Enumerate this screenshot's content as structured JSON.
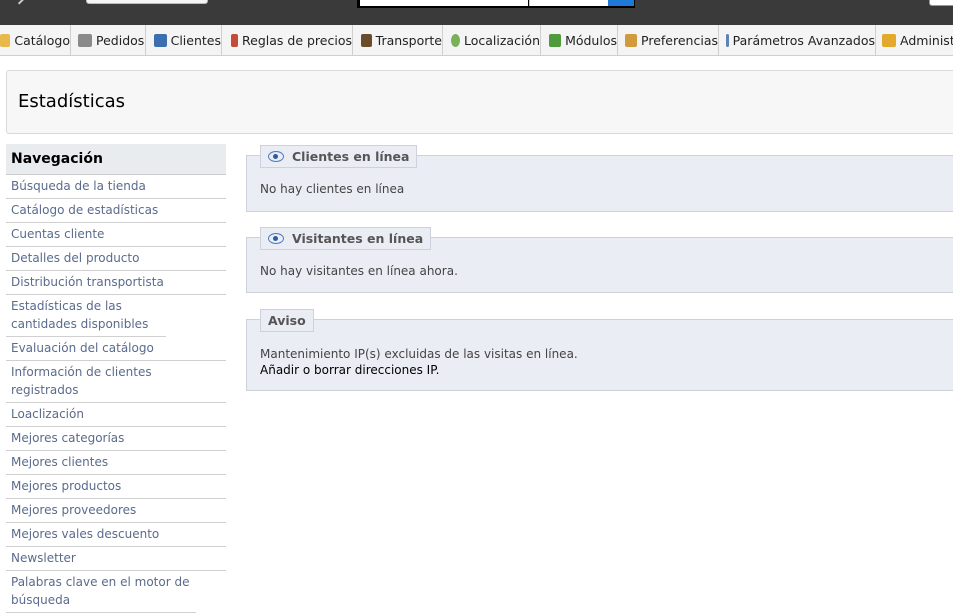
{
  "header": {
    "search": {
      "placeholder": ""
    }
  },
  "menu": [
    {
      "label": "Catálogo",
      "color": "#e8b94a"
    },
    {
      "label": "Pedidos",
      "color": "#8a8a8a"
    },
    {
      "label": "Clientes",
      "color": "#3c6fb0"
    },
    {
      "label": "Reglas de precios",
      "color": "#c64a3a"
    },
    {
      "label": "Transporte",
      "color": "#6a4b2c"
    },
    {
      "label": "Localización",
      "color": "#7ab05a"
    },
    {
      "label": "Módulos",
      "color": "#4f9a3a"
    },
    {
      "label": "Preferencias",
      "color": "#d19a3a"
    },
    {
      "label": "Parámetros Avanzados",
      "color": "#5b84b1"
    },
    {
      "label": "Administr",
      "color": "#e2a92c"
    }
  ],
  "page": {
    "title": "Estadísticas"
  },
  "sidebar": {
    "title": "Navegación",
    "items": [
      "Búsqueda de la tienda",
      "Catálogo de estadísticas",
      "Cuentas cliente",
      "Detalles del producto",
      "Distribución transportista",
      "Estadísticas de las cantidades disponibles",
      "Evaluación del catálogo",
      "Información de clientes registrados",
      "Loaclización",
      "Mejores categorías",
      "Mejores clientes",
      "Mejores productos",
      "Mejores proveedores",
      "Mejores vales descuento",
      "Newsletter",
      "Palabras clave en el motor de búsqueda"
    ]
  },
  "panels": {
    "clientes": {
      "legend": "Clientes en línea",
      "text": "No hay clientes en línea"
    },
    "visitantes": {
      "legend": "Visitantes en línea",
      "text": "No hay visitantes en línea ahora."
    },
    "aviso": {
      "legend": "Aviso",
      "text": "Mantenimiento IP(s) excluidas de las visitas en línea.",
      "link": "Añadir o borrar direcciones IP."
    }
  }
}
